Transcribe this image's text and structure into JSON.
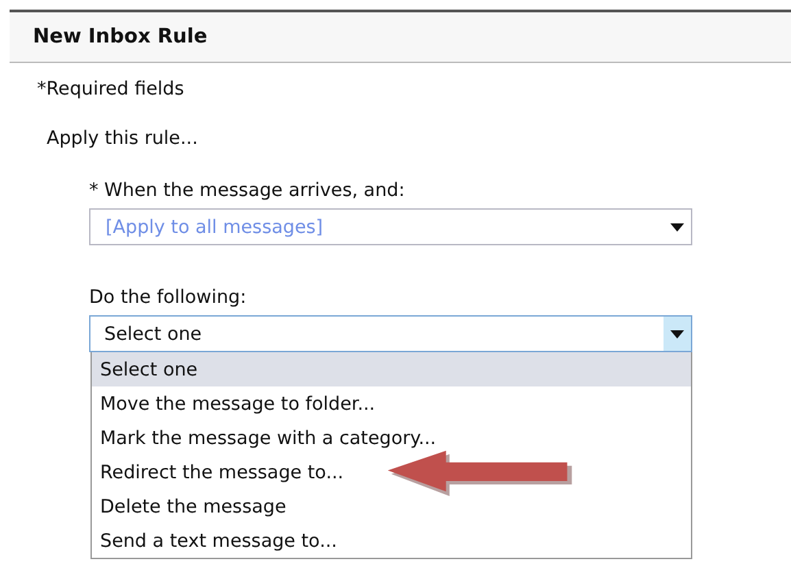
{
  "header": {
    "title": "New Inbox Rule"
  },
  "required_note": "*Required fields",
  "section_label": "Apply this rule...",
  "condition": {
    "label": "* When the message arrives, and:",
    "value": "[Apply to all messages]",
    "expanded": false
  },
  "action": {
    "label": "Do the following:",
    "value": "Select one",
    "expanded": true,
    "options": [
      {
        "label": "Select one",
        "selected": true
      },
      {
        "label": "Move the message to folder...",
        "selected": false
      },
      {
        "label": "Mark the message with a category...",
        "selected": false
      },
      {
        "label": "Redirect the message to...",
        "selected": false,
        "annotated": true
      },
      {
        "label": "Delete the message",
        "selected": false
      },
      {
        "label": "Send a text message to...",
        "selected": false
      }
    ]
  }
}
